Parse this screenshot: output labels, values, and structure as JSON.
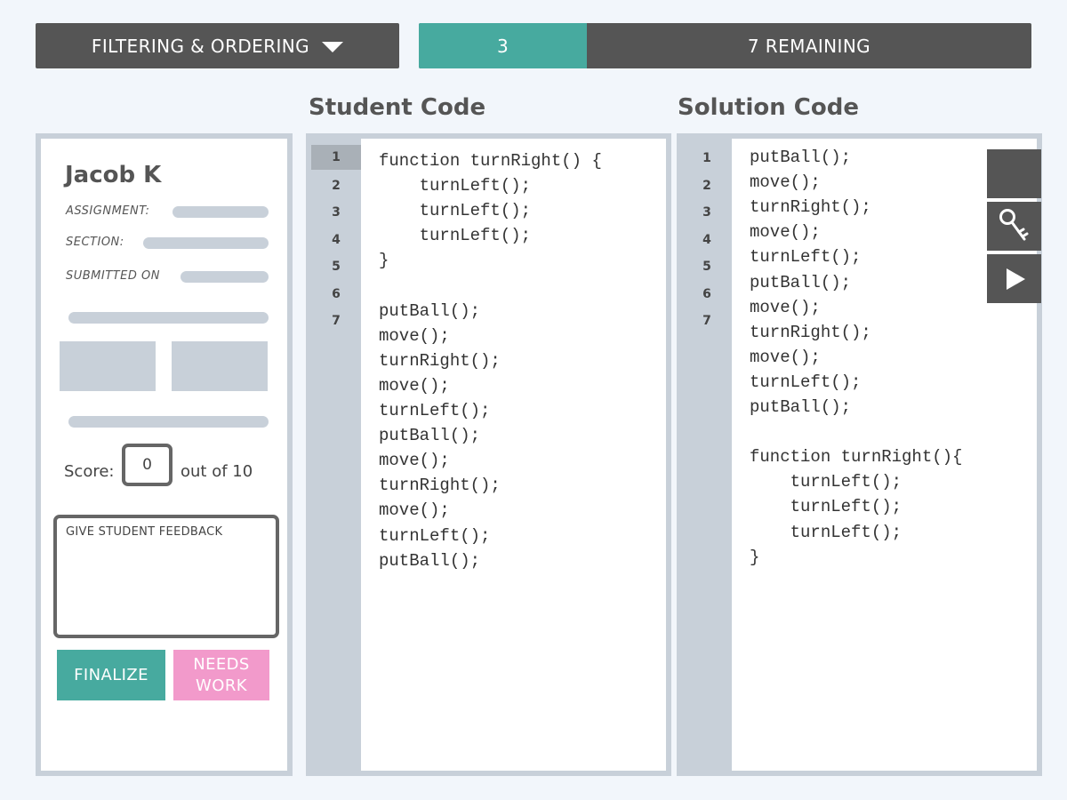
{
  "topbar": {
    "filter_label": "FILTERING & ORDERING",
    "progress_done": "3",
    "progress_remaining": "7 REMAINING",
    "progress_fraction": 0.275
  },
  "headings": {
    "student_code": "Student Code",
    "solution_code": "Solution Code"
  },
  "student": {
    "name": "Jacob K",
    "assignment_label": "ASSIGNMENT:",
    "section_label": "SECTION:",
    "submitted_label": "SUBMITTED ON",
    "score_label": "Score:",
    "score_value": "0",
    "score_suffix": "out of 10",
    "feedback_placeholder": "GIVE STUDENT FEEDBACK",
    "finalize_label": "FINALIZE",
    "needs_work_line1": "NEEDS",
    "needs_work_line2": "WORK"
  },
  "student_code": {
    "line_numbers": [
      "1",
      "2",
      "3",
      "4",
      "5",
      "6",
      "7"
    ],
    "active_line": "1",
    "lines": [
      "function turnRight() {",
      "    turnLeft();",
      "    turnLeft();",
      "    turnLeft();",
      "}",
      "",
      "putBall();",
      "move();",
      "turnRight();",
      "move();",
      "turnLeft();",
      "putBall();",
      "move();",
      "turnRight();",
      "move();",
      "turnLeft();",
      "putBall();"
    ]
  },
  "solution_code": {
    "line_numbers": [
      "1",
      "2",
      "3",
      "4",
      "5",
      "6",
      "7"
    ],
    "lines": [
      "putBall();",
      "move();",
      "turnRight();",
      "move();",
      "turnLeft();",
      "putBall();",
      "move();",
      "turnRight();",
      "move();",
      "turnLeft();",
      "putBall();",
      "",
      "function turnRight(){",
      "    turnLeft();",
      "    turnLeft();",
      "    turnLeft();",
      "}"
    ]
  },
  "toolbar": {
    "icons": [
      "blank-icon",
      "key-icon",
      "play-icon"
    ]
  },
  "colors": {
    "dark": "#555555",
    "teal": "#47aa9f",
    "pink": "#f29acb",
    "gray_border": "#c8d0d9",
    "background": "#f2f6fb"
  }
}
